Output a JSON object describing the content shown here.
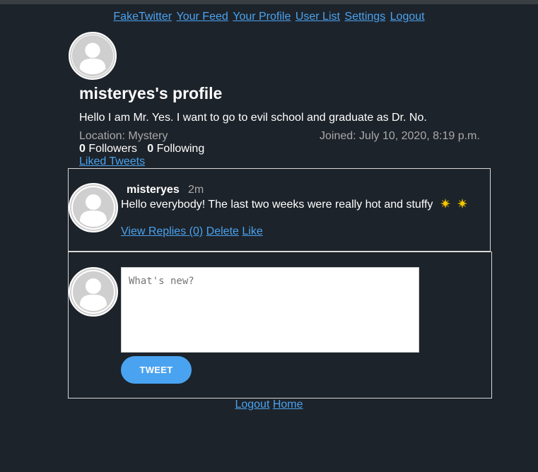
{
  "nav": {
    "brand": "FakeTwitter",
    "links": [
      "Your Feed",
      "Your Profile",
      "User List",
      "Settings",
      "Logout"
    ]
  },
  "profile": {
    "title": "misteryes's profile",
    "bio": "Hello I am Mr. Yes. I want to go to evil school and graduate as Dr. No.",
    "location": "Location: Mystery",
    "joined": "Joined: July 10, 2020, 8:19 p.m.",
    "followers_count": "0",
    "followers_label": "Followers",
    "following_count": "0",
    "following_label": "Following",
    "liked_link": "Liked Tweets"
  },
  "tweets": [
    {
      "author": "misteryes",
      "time": "2m",
      "text": "Hello everybody! The last two weeks were really hot and stuffy",
      "emoji_icons": [
        "sun-icon",
        "sun-icon"
      ],
      "actions": {
        "view_replies": "View Replies (0)",
        "delete": "Delete",
        "like": "Like"
      }
    }
  ],
  "compose": {
    "placeholder": "What's new?",
    "value": "",
    "button_label": "TWEET"
  },
  "footer": {
    "links": [
      "Logout",
      "Home"
    ]
  },
  "colors": {
    "background": "#1d232a",
    "link": "#4aa3f0",
    "muted_text": "#a9a9a9",
    "border": "#d8d8d8",
    "button": "#4aa3f0",
    "sun": "#f5c400"
  }
}
